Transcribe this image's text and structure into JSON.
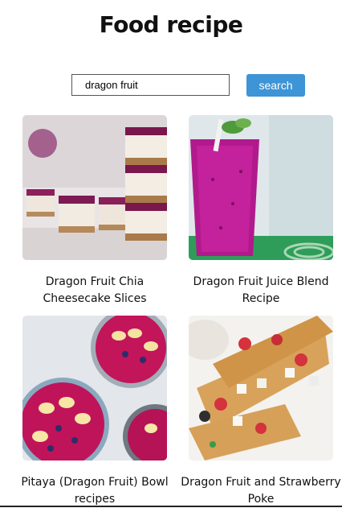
{
  "header": {
    "title": "Food recipe"
  },
  "search": {
    "value": "dragon fruit",
    "button_label": "search"
  },
  "recipes": [
    {
      "title": "Dragon Fruit Chia Cheesecake Slices"
    },
    {
      "title": "Dragon Fruit Juice Blend Recipe"
    },
    {
      "title": "Pitaya (Dragon Fruit) Bowl recipes"
    },
    {
      "title": "Dragon Fruit and Strawberry Poke"
    }
  ]
}
